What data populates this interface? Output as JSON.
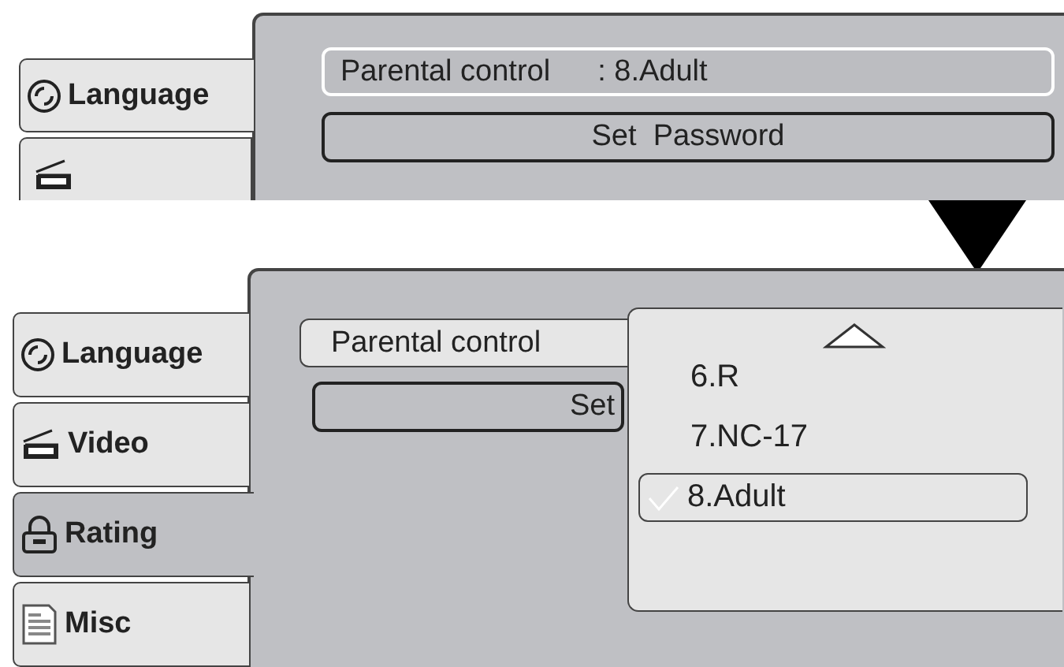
{
  "screens": [
    {
      "tabs": [
        {
          "label": "Language",
          "kind": "language",
          "selected": false
        }
      ],
      "more_tabs_below": true,
      "parental_control": {
        "label": "Parental control",
        "value": ": 8.Adult",
        "selected": true
      },
      "set_password": {
        "label": "Set  Password"
      }
    },
    {
      "tabs": [
        {
          "label": "Language",
          "kind": "language",
          "selected": false
        },
        {
          "label": "Video",
          "kind": "video",
          "selected": false
        },
        {
          "label": "Rating",
          "kind": "rating",
          "selected": true
        },
        {
          "label": "Misc",
          "kind": "misc",
          "selected": false
        }
      ],
      "parental_control": {
        "label": "Parental control",
        "selected": false
      },
      "set_password": {
        "label": "Set"
      },
      "dropdown": {
        "options": [
          {
            "label": "6.R",
            "selected": false,
            "checked": false
          },
          {
            "label": "7.NC-17",
            "selected": false,
            "checked": false
          },
          {
            "label": "8.Adult",
            "selected": true,
            "checked": true
          }
        ]
      }
    }
  ]
}
